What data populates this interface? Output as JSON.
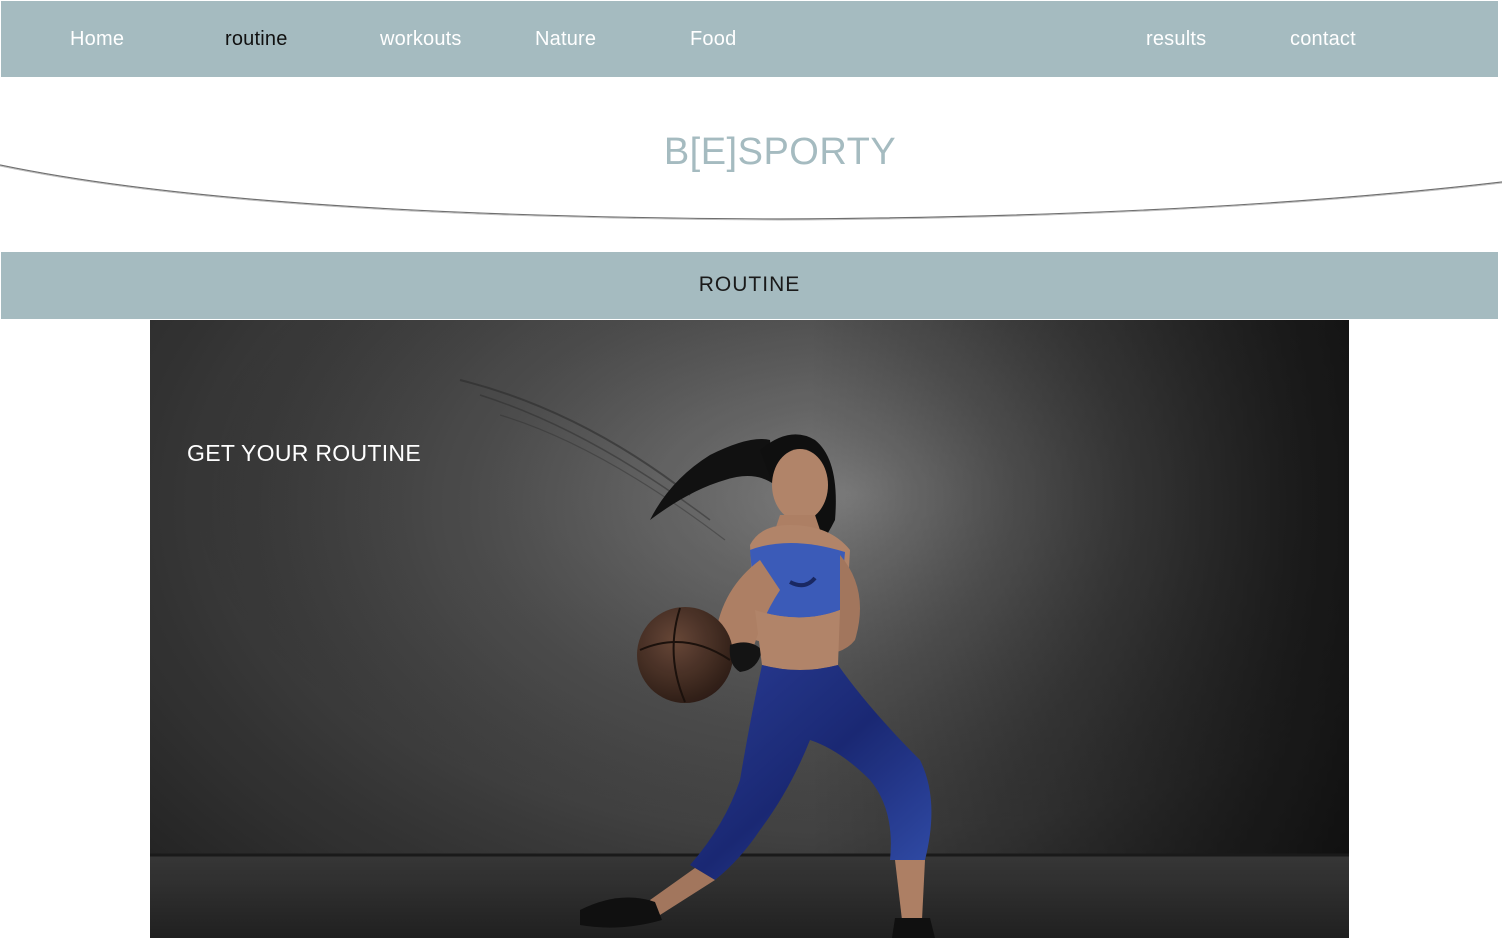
{
  "nav": {
    "items": [
      {
        "label": "Home"
      },
      {
        "label": "routine"
      },
      {
        "label": "workouts"
      },
      {
        "label": "Nature"
      },
      {
        "label": "Food"
      },
      {
        "label": "results"
      },
      {
        "label": "contact"
      }
    ],
    "active": "routine"
  },
  "header": {
    "logo": "B[E]SPORTY"
  },
  "section": {
    "title": "ROUTINE"
  },
  "hero": {
    "title": "GET YOUR ROUTINE"
  },
  "colors": {
    "accent": "#a5bbc0",
    "nav_text": "#ffffff",
    "active_nav_text": "#111111"
  }
}
